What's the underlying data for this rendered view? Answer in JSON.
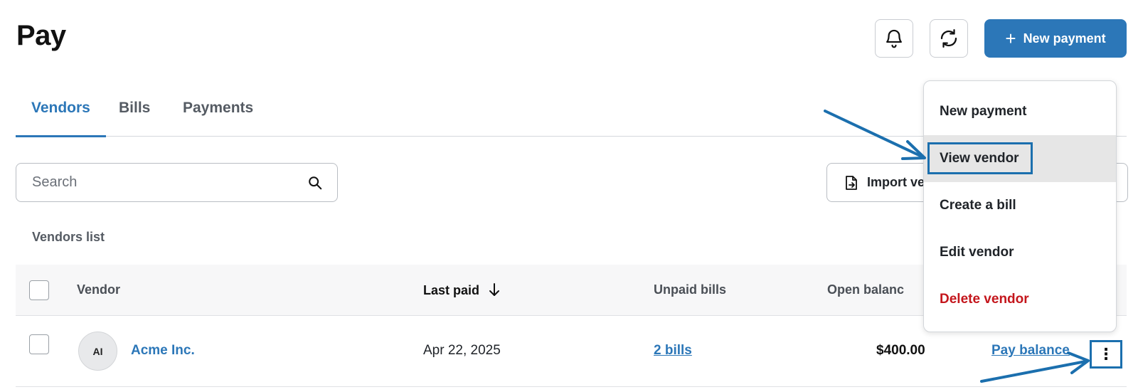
{
  "header": {
    "title": "Pay",
    "new_payment_label": "New payment"
  },
  "tabs": [
    {
      "label": "Vendors",
      "active": true
    },
    {
      "label": "Bills",
      "active": false
    },
    {
      "label": "Payments",
      "active": false
    }
  ],
  "search": {
    "placeholder": "Search"
  },
  "import_button": {
    "label": "Import ve"
  },
  "list": {
    "label": "Vendors list"
  },
  "table": {
    "columns": [
      "Vendor",
      "Last paid",
      "Unpaid bills",
      "Open balanc"
    ],
    "rows": [
      {
        "avatar": "AI",
        "vendor": "Acme Inc.",
        "last_paid": "Apr 22, 2025",
        "unpaid_bills": "2 bills",
        "open_balance": "$400.00",
        "action": "Pay balance"
      }
    ]
  },
  "menu": {
    "items": [
      {
        "label": "New payment"
      },
      {
        "label": "View vendor",
        "hovered": true
      },
      {
        "label": "Create a bill"
      },
      {
        "label": "Edit vendor"
      },
      {
        "label": "Delete vendor",
        "danger": true
      }
    ]
  },
  "colors": {
    "accent": "#2c77b8",
    "annotation": "#1b6fae",
    "danger": "#c4161c"
  },
  "icons": [
    "bell-icon",
    "refresh-icon",
    "plus-icon",
    "search-icon",
    "import-file-icon",
    "sort-down-icon",
    "kebab-menu-icon"
  ]
}
